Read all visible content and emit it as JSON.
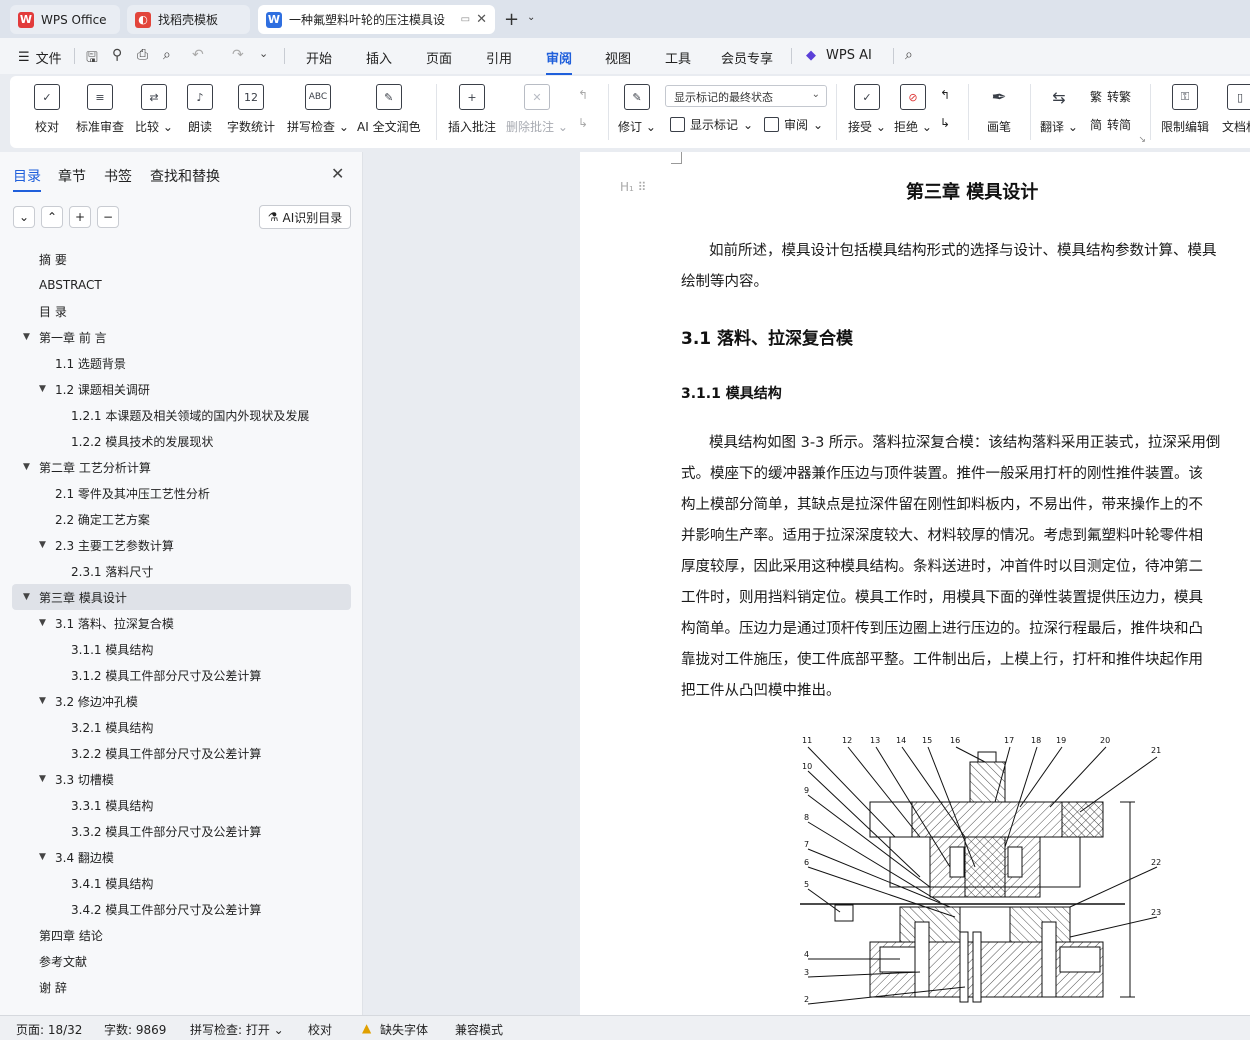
{
  "tabs": [
    {
      "label": "WPS Office",
      "logo": "W",
      "logo_color": "#e23b3b"
    },
    {
      "label": "找稻壳模板",
      "logo": "D",
      "logo_color": "#e2453b"
    },
    {
      "label": "一种氟塑料叶轮的压注模具设",
      "logo": "W",
      "logo_color": "#2f6fe0"
    }
  ],
  "menubar": {
    "file": "文件",
    "tabs": [
      "开始",
      "插入",
      "页面",
      "引用",
      "审阅",
      "视图",
      "工具",
      "会员专享",
      "WPS AI"
    ],
    "active_tab": "审阅"
  },
  "ribbon": {
    "proofread": "校对",
    "standard_review": "标准审查",
    "compare": "比较",
    "read_aloud": "朗读",
    "word_count": "字数统计",
    "spell_check": "拼写检查",
    "ai_polish": "AI 全文润色",
    "insert_comment": "插入批注",
    "delete_comment": "删除批注",
    "track_changes": "修订",
    "markup_mode": "显示标记的最终状态",
    "show_markup": "显示标记",
    "review_pane": "审阅",
    "accept": "接受",
    "reject": "拒绝",
    "ink": "画笔",
    "translate": "翻译",
    "to_traditional": "转繁",
    "to_simplified": "转简",
    "restrict_edit": "限制编辑",
    "doc_permission": "文档权"
  },
  "nav": {
    "tabs": [
      "目录",
      "章节",
      "书签",
      "查找和替换"
    ],
    "ai_button": "AI识别目录",
    "items": [
      {
        "label": "摘  要",
        "level": 1,
        "toggle": ""
      },
      {
        "label": "ABSTRACT",
        "level": 1,
        "toggle": ""
      },
      {
        "label": "目  录",
        "level": 1,
        "toggle": ""
      },
      {
        "label": "第一章  前    言",
        "level": 1,
        "toggle": "▼"
      },
      {
        "label": "1.1 选题背景",
        "level": 2,
        "toggle": ""
      },
      {
        "label": "1.2  课题相关调研",
        "level": 2,
        "toggle": "▼"
      },
      {
        "label": "1.2.1    本课题及相关领域的国内外现状及发展",
        "level": 3,
        "toggle": ""
      },
      {
        "label": "1.2.2    模具技术的发展现状",
        "level": 3,
        "toggle": ""
      },
      {
        "label": "第二章  工艺分析计算",
        "level": 1,
        "toggle": "▼"
      },
      {
        "label": "2.1    零件及其冲压工艺性分析",
        "level": 2,
        "toggle": ""
      },
      {
        "label": "2.2  确定工艺方案",
        "level": 2,
        "toggle": ""
      },
      {
        "label": "2.3 主要工艺参数计算",
        "level": 2,
        "toggle": "▼"
      },
      {
        "label": "2.3.1   落料尺寸",
        "level": 3,
        "toggle": ""
      },
      {
        "label": "第三章  模具设计",
        "level": 1,
        "toggle": "▼",
        "selected": true
      },
      {
        "label": "3.1  落料、拉深复合模",
        "level": 2,
        "toggle": "▼"
      },
      {
        "label": "3.1.1 模具结构",
        "level": 3,
        "toggle": ""
      },
      {
        "label": "3.1.2  模具工件部分尺寸及公差计算",
        "level": 3,
        "toggle": ""
      },
      {
        "label": "3.2 修边冲孔模",
        "level": 2,
        "toggle": "▼"
      },
      {
        "label": "3.2.1 模具结构",
        "level": 3,
        "toggle": ""
      },
      {
        "label": "3.2.2  模具工件部分尺寸及公差计算",
        "level": 3,
        "toggle": ""
      },
      {
        "label": "3.3  切槽模",
        "level": 2,
        "toggle": "▼"
      },
      {
        "label": "3.3.1 模具结构",
        "level": 3,
        "toggle": ""
      },
      {
        "label": "3.3.2  模具工件部分尺寸及公差计算",
        "level": 3,
        "toggle": ""
      },
      {
        "label": "3.4  翻边模",
        "level": 2,
        "toggle": "▼"
      },
      {
        "label": "3.4.1 模具结构",
        "level": 3,
        "toggle": ""
      },
      {
        "label": "3.4.2  模具工件部分尺寸及公差计算",
        "level": 3,
        "toggle": ""
      },
      {
        "label": "第四章  结论",
        "level": 1,
        "toggle": ""
      },
      {
        "label": "参考文献",
        "level": 1,
        "toggle": ""
      },
      {
        "label": "谢          辞",
        "level": 1,
        "toggle": ""
      }
    ]
  },
  "document": {
    "chapter_title": "第三章  模具设计",
    "intro_lines": [
      "如前所述，模具设计包括模具结构形式的选择与设计、模具结构参数计算、模具",
      "绘制等内容。"
    ],
    "section_title": "3.1  落料、拉深复合模",
    "subsection_title": "3.1.1 模具结构",
    "body_lines": [
      "模具结构如图 3-3 所示。落料拉深复合模：该结构落料采用正装式，拉深采用倒",
      "式。模座下的缓冲器兼作压边与顶件装置。推件一般采用打杆的刚性推件装置。该",
      "构上模部分简单，其缺点是拉深件留在刚性卸料板内，不易出件，带来操作上的不",
      "并影响生产率。适用于拉深深度较大、材料较厚的情况。考虑到氟塑料叶轮零件相",
      "厚度较厚，因此采用这种模具结构。条料送进时，冲首件时以目测定位，待冲第二",
      "工件时，则用挡料销定位。模具工作时，用模具下面的弹性装置提供压边力，模具",
      "构简单。压边力是通过顶杆传到压边圈上进行压边的。拉深行程最后，推件块和凸",
      "靠拢对工件施压，使工件底部平整。工件制出后，上模上行，打杆和推件块起作用",
      "把工件从凸凹模中推出。"
    ],
    "figure_labels_top": [
      "11",
      "12",
      "13",
      "14",
      "15",
      "16",
      "17",
      "18",
      "19",
      "20",
      "21"
    ],
    "figure_labels_left": [
      "10",
      "9",
      "8",
      "7",
      "6",
      "5",
      "4",
      "3",
      "2"
    ],
    "figure_labels_right": [
      "22",
      "23"
    ]
  },
  "status": {
    "page": "页面: 18/32",
    "words": "字数: 9869",
    "spell": "拼写检查: 打开",
    "proof": "校对",
    "missing_font": "缺失字体",
    "compat": "兼容模式"
  }
}
